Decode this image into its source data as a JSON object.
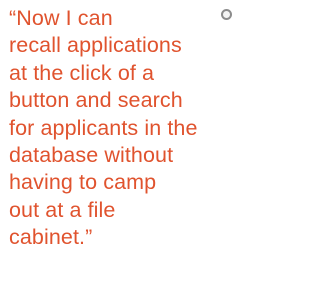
{
  "quote": {
    "text": "“Now I can\nrecall applications\nat the click of a\nbutton and search\nfor applicants in the\ndatabase without\nhaving to camp\nout at a file\ncabinet.”",
    "color": "#e0532e"
  },
  "marker": {
    "icon": "circle-icon",
    "color": "#8c8c8c"
  }
}
